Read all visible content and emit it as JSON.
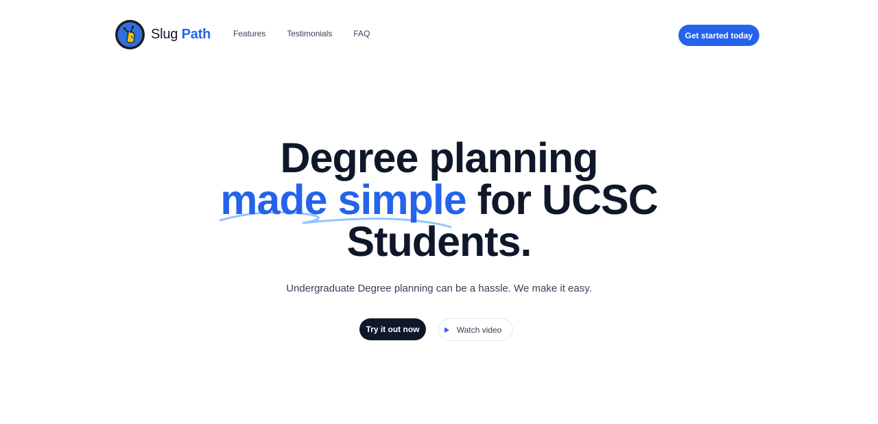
{
  "brand": {
    "name_part1": "Slug",
    "name_part2": "Path",
    "logo_icon": "slug-mascot-icon",
    "accent_color": "#2563eb"
  },
  "nav": {
    "links": [
      {
        "label": "Features"
      },
      {
        "label": "Testimonials"
      },
      {
        "label": "FAQ"
      }
    ],
    "cta_label": "Get started today"
  },
  "hero": {
    "headline_line1": "Degree planning",
    "headline_highlight": "made simple",
    "headline_line2_rest": " for UCSC",
    "headline_line3": "Students.",
    "subheadline": "Undergraduate Degree planning can be a hassle. We make it easy.",
    "primary_button": "Try it out now",
    "secondary_button": "Watch video",
    "secondary_icon": "play-icon"
  },
  "colors": {
    "primary": "#2563eb",
    "dark": "#0f172a",
    "text_muted": "#334155"
  }
}
